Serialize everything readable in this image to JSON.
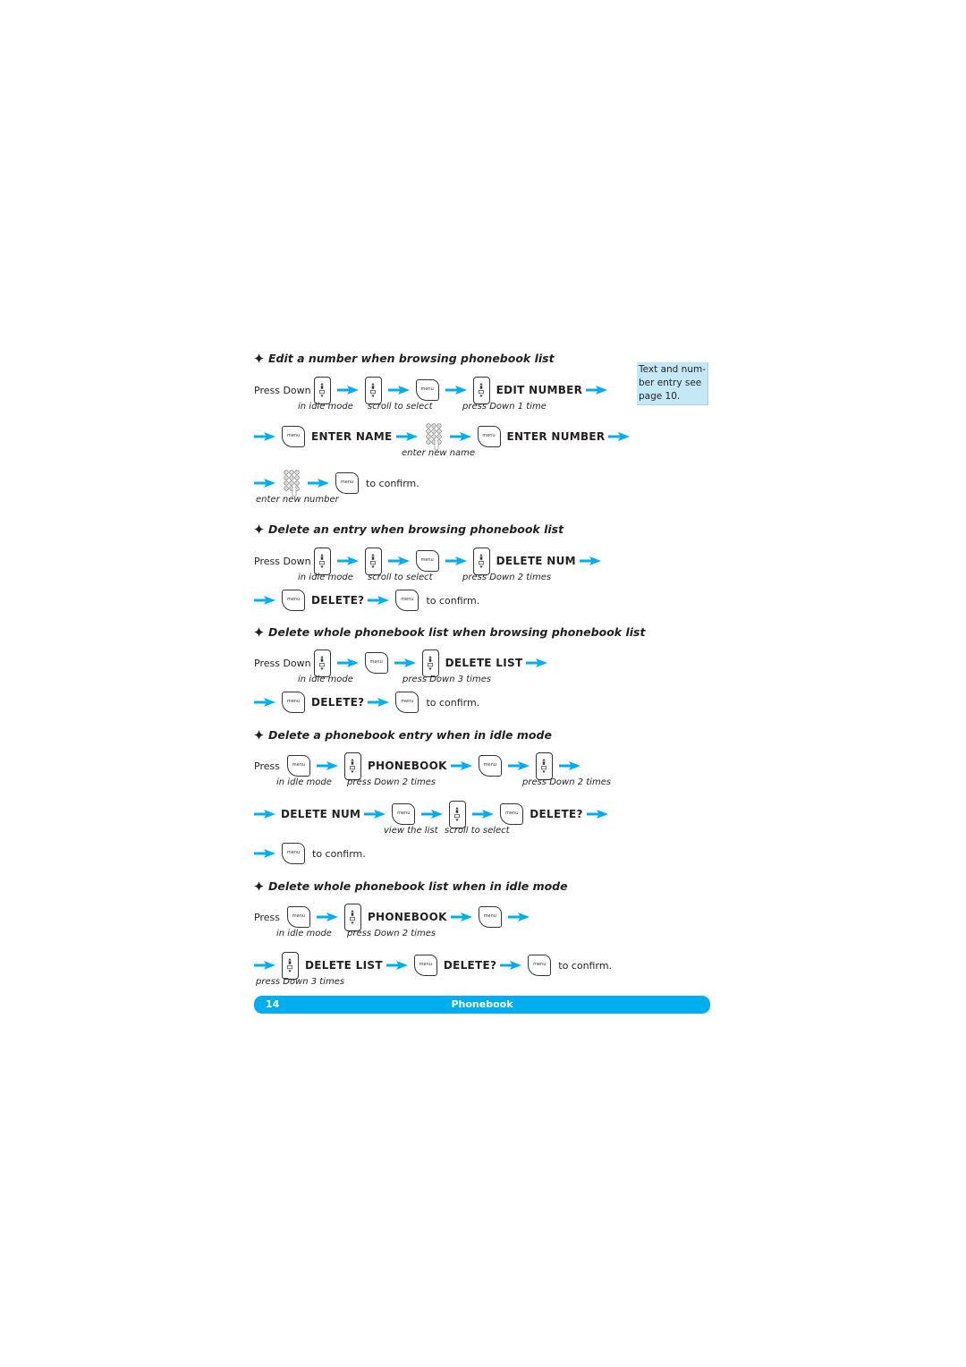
{
  "sections": [
    {
      "title": "Edit a number when browsing phonebook list",
      "rows": [
        {
          "items": [
            "Press Down",
            "in idle mode",
            "scroll to select",
            "press Down 1 time",
            "EDIT NUMBER"
          ]
        },
        {
          "items": [
            "ENTER NAME",
            "enter new name",
            "ENTER NUMBER"
          ]
        },
        {
          "items": [
            "enter new number",
            "to confirm."
          ]
        }
      ],
      "note": "Text and num- ber entry see page 10."
    },
    {
      "title": "Delete an entry when browsing phonebook list",
      "rows": [
        {
          "items": [
            "Press Down",
            "in idle mode",
            "scroll to select",
            "press Down 2 times",
            "DELETE NUM"
          ]
        },
        {
          "items": [
            "DELETE?",
            "to confirm."
          ]
        }
      ]
    },
    {
      "title": "Delete whole phonebook list when browsing phonebook list",
      "rows": [
        {
          "items": [
            "Press Down",
            "in idle mode",
            "press Down 3 times",
            "DELETE LIST"
          ]
        },
        {
          "items": [
            "DELETE?",
            "to confirm."
          ]
        }
      ]
    },
    {
      "title": "Delete a phonebook entry when in idle mode",
      "rows": [
        {
          "items": [
            "Press",
            "in idle mode",
            "press Down 2 times",
            "PHONEBOOK",
            "press Down 2 times"
          ]
        },
        {
          "items": [
            "DELETE NUM",
            "view the list",
            "scroll to select",
            "DELETE?"
          ]
        },
        {
          "items": [
            "to confirm."
          ]
        }
      ]
    },
    {
      "title": "Delete whole phonebook list when in idle mode",
      "rows": [
        {
          "items": [
            "Press",
            "in idle mode",
            "press Down 2 times",
            "PHONEBOOK"
          ]
        },
        {
          "items": [
            "press Down 3 times",
            "DELETE LIST",
            "DELETE?",
            "to confirm."
          ]
        }
      ]
    }
  ],
  "icons": {
    "menu_key_label": "menu"
  },
  "footer": {
    "page_number": "14",
    "section": "Phonebook"
  },
  "colors": {
    "accent": "#00aeef",
    "note_bg": "#c5e8f7",
    "text": "#231f20"
  }
}
